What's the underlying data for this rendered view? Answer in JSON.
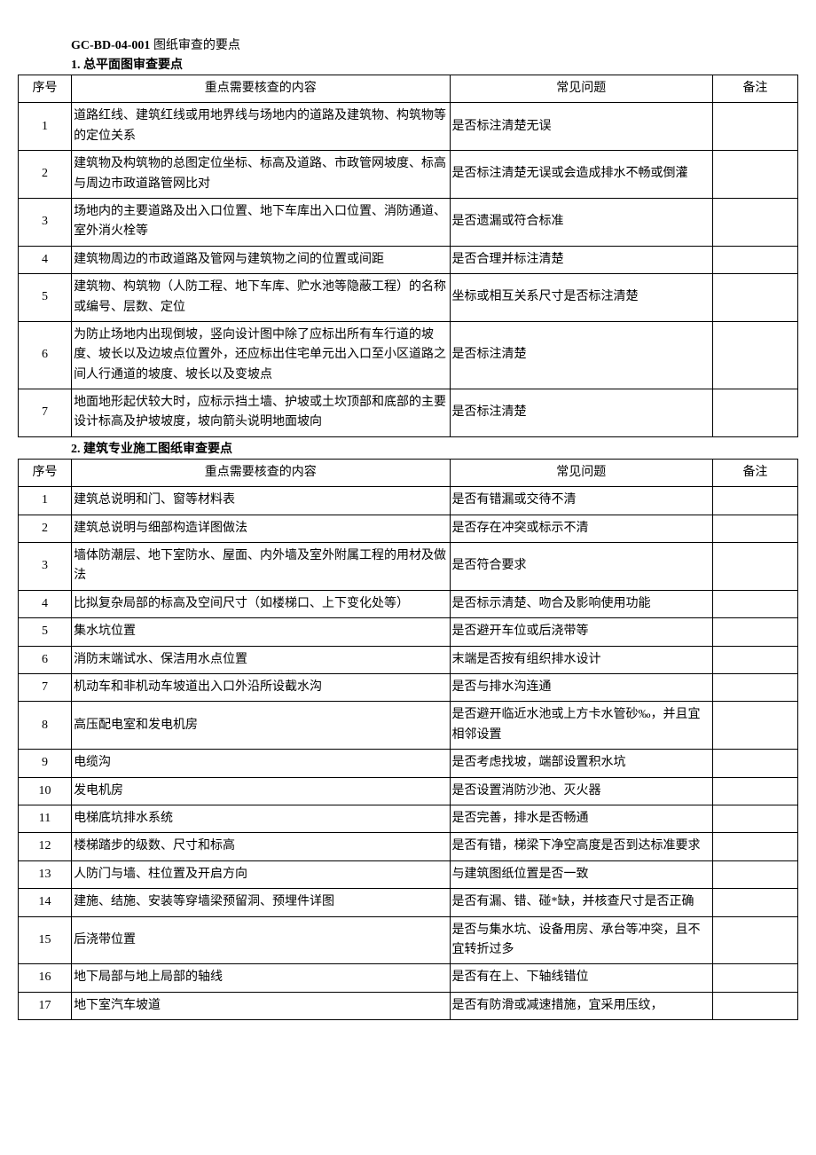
{
  "doc_title_code": "GC-BD-04-001",
  "doc_title_text": "图纸审查的要点",
  "sections": [
    {
      "heading": "1. 总平面图审查要点",
      "headers": {
        "idx": "序号",
        "check": "重点需要核查的内容",
        "issue": "常见问题",
        "note": "备注"
      },
      "rows": [
        {
          "idx": "1",
          "check": "道路红线、建筑红线或用地界线与场地内的道路及建筑物、构筑物等的定位关系",
          "issue": "是否标注清楚无误",
          "note": ""
        },
        {
          "idx": "2",
          "check": "建筑物及构筑物的总图定位坐标、标高及道路、市政管网坡度、标高与周边市政道路管网比对",
          "issue": "是否标注清楚无误或会造成排水不畅或倒灌",
          "note": ""
        },
        {
          "idx": "3",
          "check": "场地内的主要道路及出入口位置、地下车库出入口位置、消防通道、室外消火栓等",
          "issue": "是否遗漏或符合标准",
          "note": ""
        },
        {
          "idx": "4",
          "check": "建筑物周边的市政道路及管网与建筑物之间的位置或间距",
          "issue": "是否合理并标注清楚",
          "note": ""
        },
        {
          "idx": "5",
          "check": "建筑物、构筑物（人防工程、地下车库、贮水池等隐蔽工程）的名称或编号、层数、定位",
          "issue": "坐标或相互关系尺寸是否标注清楚",
          "note": ""
        },
        {
          "idx": "6",
          "check": "为防止场地内出现倒坡，竖向设计图中除了应标出所有车行道的坡度、坡长以及边坡点位置外，还应标出住宅单元出入口至小区道路之间人行通道的坡度、坡长以及变坡点",
          "issue": "是否标注清楚",
          "note": ""
        },
        {
          "idx": "7",
          "check": "地面地形起伏较大时，应标示挡土墙、护坡或土坎顶部和底部的主要设计标高及护坡坡度，坡向箭头说明地面坡向",
          "issue": "是否标注清楚",
          "note": ""
        }
      ]
    },
    {
      "heading": "2. 建筑专业施工图纸审查要点",
      "headers": {
        "idx": "序号",
        "check": "重点需要核查的内容",
        "issue": "常见问题",
        "note": "备注"
      },
      "rows": [
        {
          "idx": "1",
          "check": "建筑总说明和门、窗等材料表",
          "issue": "是否有错漏或交待不清",
          "note": ""
        },
        {
          "idx": "2",
          "check": "建筑总说明与细部构造详图做法",
          "issue": "是否存在冲突或标示不清",
          "note": ""
        },
        {
          "idx": "3",
          "check": "墙体防潮层、地下室防水、屋面、内外墙及室外附属工程的用材及做法",
          "issue": "是否符合要求",
          "note": ""
        },
        {
          "idx": "4",
          "check": "比拟复杂局部的标高及空间尺寸（如楼梯口、上下变化处等）",
          "issue": "是否标示清楚、吻合及影响使用功能",
          "note": ""
        },
        {
          "idx": "5",
          "check": "集水坑位置",
          "issue": "是否避开车位或后浇带等",
          "note": ""
        },
        {
          "idx": "6",
          "check": "消防末端试水、保洁用水点位置",
          "issue": "末端是否按有组织排水设计",
          "note": ""
        },
        {
          "idx": "7",
          "check": "机动车和非机动车坡道出入口外沿所设截水沟",
          "issue": "是否与排水沟连通",
          "note": ""
        },
        {
          "idx": "8",
          "check": "高压配电室和发电机房",
          "issue": "是否避开临近水池或上方卡水管砂‰，并且宜相邻设置",
          "note": ""
        },
        {
          "idx": "9",
          "check": "电缆沟",
          "issue": "是否考虑找坡，端部设置积水坑",
          "note": ""
        },
        {
          "idx": "10",
          "check": "发电机房",
          "issue": "是否设置消防沙池、灭火器",
          "note": ""
        },
        {
          "idx": "11",
          "check": "电梯底坑排水系统",
          "issue": "是否完善，排水是否畅通",
          "note": ""
        },
        {
          "idx": "12",
          "check": "楼梯踏步的级数、尺寸和标高",
          "issue": "是否有错，梯梁下净空高度是否到达标准要求",
          "note": ""
        },
        {
          "idx": "13",
          "check": "人防门与墙、柱位置及开启方向",
          "issue": "与建筑图纸位置是否一致",
          "note": ""
        },
        {
          "idx": "14",
          "check": "建施、结施、安装等穿墙梁预留洞、预埋件详图",
          "issue": "是否有漏、错、碰*缺，并核查尺寸是否正确",
          "note": ""
        },
        {
          "idx": "15",
          "check": "后浇带位置",
          "issue": "是否与集水坑、设备用房、承台等冲突，且不宜转折过多",
          "note": ""
        },
        {
          "idx": "16",
          "check": "地下局部与地上局部的轴线",
          "issue": "是否有在上、下轴线错位",
          "note": ""
        },
        {
          "idx": "17",
          "check": "地下室汽车坡道",
          "issue": "是否有防滑或减速措施，宜采用压纹，",
          "note": ""
        }
      ]
    }
  ]
}
